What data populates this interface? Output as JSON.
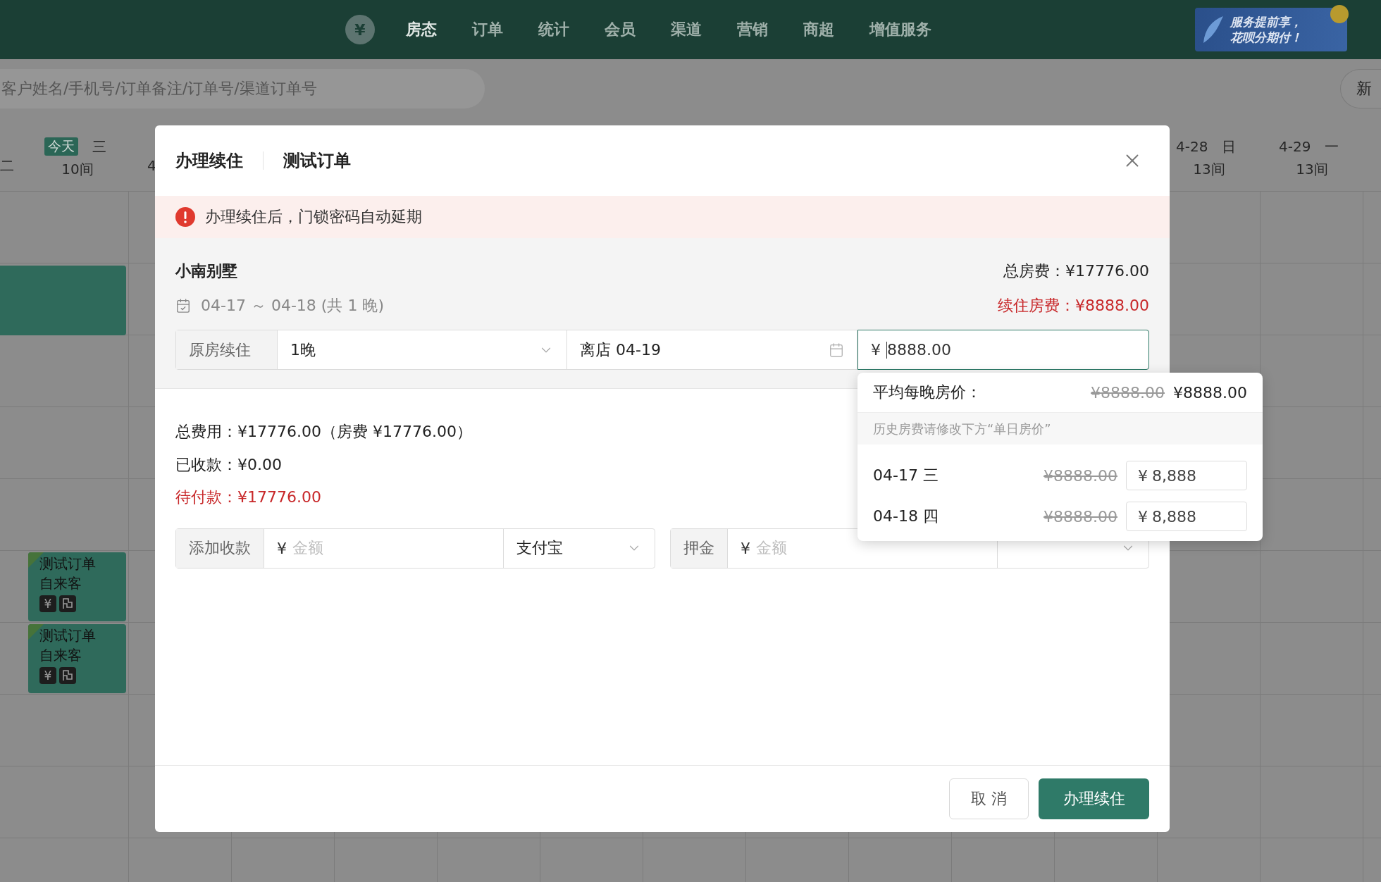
{
  "nav": {
    "logo": "¥",
    "items": [
      {
        "label": "房态",
        "selected": true
      },
      {
        "label": "订单",
        "selected": false
      },
      {
        "label": "统计",
        "selected": false
      },
      {
        "label": "会员",
        "selected": false
      },
      {
        "label": "渠道",
        "selected": false
      },
      {
        "label": "营销",
        "selected": false
      },
      {
        "label": "商超",
        "selected": false
      },
      {
        "label": "增值服务",
        "selected": false
      }
    ],
    "banner": [
      "服务提前享，",
      "花呗分期付！"
    ]
  },
  "search": {
    "placeholder": "客户姓名/手机号/订单备注/订单号/渠道订单号"
  },
  "new_button": "新",
  "days_left": [
    {
      "weekday": "二"
    },
    {
      "badge": "今天",
      "weekday": "三",
      "rooms": "10间"
    },
    {
      "date": "4"
    }
  ],
  "days_right": [
    {
      "date": "4-28",
      "weekday": "日",
      "rooms": "13间"
    },
    {
      "date": "4-29",
      "weekday": "一",
      "rooms": "13间"
    }
  ],
  "bookings": [
    {
      "kind": "block"
    },
    {
      "kind": "order",
      "title": "测试订单",
      "guest": "自来客",
      "badge": "¥"
    },
    {
      "kind": "order",
      "title": "测试订单",
      "guest": "自来客",
      "badge": "¥"
    }
  ],
  "dialog": {
    "title": "办理续住",
    "order": "测试订单",
    "alert": "办理续住后，门锁密码自动延期",
    "room": {
      "name": "小南别墅",
      "dates": "04-17 ～ 04-18 (共 1 晚)",
      "total": "总房费：¥17776.00",
      "extend_fee": "续住房费：¥8888.00"
    },
    "extend_row": {
      "addon": "原房续住",
      "nights": "1晚",
      "checkout": "离店 04-19",
      "currency": "¥",
      "price": "8888.00",
      "focused": true
    },
    "price_popover": {
      "label": "平均每晚房价：",
      "old": "¥8888.00",
      "new": "¥8888.00",
      "hint": "历史房费请修改下方“单日房价”",
      "nights": [
        {
          "date": "04-17 三",
          "old": "¥8888.00",
          "currency": "¥",
          "value": "8,888"
        },
        {
          "date": "04-18 四",
          "old": "¥8888.00",
          "currency": "¥",
          "value": "8,888"
        }
      ]
    },
    "summary": [
      {
        "kind": "normal",
        "text": "总费用：¥17776.00（房费 ¥17776.00）"
      },
      {
        "kind": "normal",
        "text": "已收款：¥0.00"
      },
      {
        "kind": "due",
        "text": "待付款：¥17776.00"
      }
    ],
    "payments": [
      {
        "addon": "添加收款",
        "currency": "¥",
        "placeholder": "金额",
        "method": "支付宝"
      },
      {
        "addon": "押金",
        "currency": "¥",
        "placeholder": "金额"
      }
    ],
    "buttons": [
      {
        "kind": "default",
        "label": "取 消"
      },
      {
        "kind": "primary",
        "label": "办理续住"
      }
    ]
  }
}
